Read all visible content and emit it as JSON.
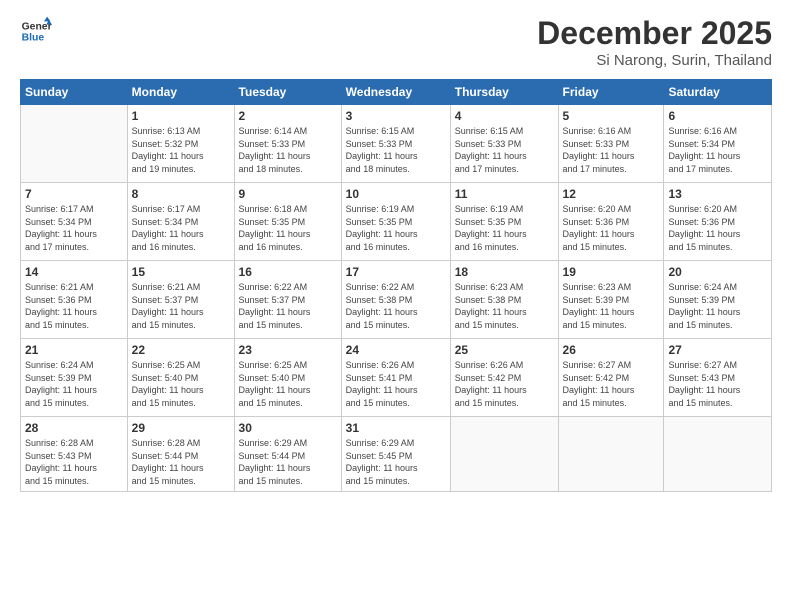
{
  "header": {
    "logo_line1": "General",
    "logo_line2": "Blue",
    "month": "December 2025",
    "location": "Si Narong, Surin, Thailand"
  },
  "weekdays": [
    "Sunday",
    "Monday",
    "Tuesday",
    "Wednesday",
    "Thursday",
    "Friday",
    "Saturday"
  ],
  "weeks": [
    [
      {
        "day": "",
        "info": ""
      },
      {
        "day": "1",
        "info": "Sunrise: 6:13 AM\nSunset: 5:32 PM\nDaylight: 11 hours\nand 19 minutes."
      },
      {
        "day": "2",
        "info": "Sunrise: 6:14 AM\nSunset: 5:33 PM\nDaylight: 11 hours\nand 18 minutes."
      },
      {
        "day": "3",
        "info": "Sunrise: 6:15 AM\nSunset: 5:33 PM\nDaylight: 11 hours\nand 18 minutes."
      },
      {
        "day": "4",
        "info": "Sunrise: 6:15 AM\nSunset: 5:33 PM\nDaylight: 11 hours\nand 17 minutes."
      },
      {
        "day": "5",
        "info": "Sunrise: 6:16 AM\nSunset: 5:33 PM\nDaylight: 11 hours\nand 17 minutes."
      },
      {
        "day": "6",
        "info": "Sunrise: 6:16 AM\nSunset: 5:34 PM\nDaylight: 11 hours\nand 17 minutes."
      }
    ],
    [
      {
        "day": "7",
        "info": "Sunrise: 6:17 AM\nSunset: 5:34 PM\nDaylight: 11 hours\nand 17 minutes."
      },
      {
        "day": "8",
        "info": "Sunrise: 6:17 AM\nSunset: 5:34 PM\nDaylight: 11 hours\nand 16 minutes."
      },
      {
        "day": "9",
        "info": "Sunrise: 6:18 AM\nSunset: 5:35 PM\nDaylight: 11 hours\nand 16 minutes."
      },
      {
        "day": "10",
        "info": "Sunrise: 6:19 AM\nSunset: 5:35 PM\nDaylight: 11 hours\nand 16 minutes."
      },
      {
        "day": "11",
        "info": "Sunrise: 6:19 AM\nSunset: 5:35 PM\nDaylight: 11 hours\nand 16 minutes."
      },
      {
        "day": "12",
        "info": "Sunrise: 6:20 AM\nSunset: 5:36 PM\nDaylight: 11 hours\nand 15 minutes."
      },
      {
        "day": "13",
        "info": "Sunrise: 6:20 AM\nSunset: 5:36 PM\nDaylight: 11 hours\nand 15 minutes."
      }
    ],
    [
      {
        "day": "14",
        "info": "Sunrise: 6:21 AM\nSunset: 5:36 PM\nDaylight: 11 hours\nand 15 minutes."
      },
      {
        "day": "15",
        "info": "Sunrise: 6:21 AM\nSunset: 5:37 PM\nDaylight: 11 hours\nand 15 minutes."
      },
      {
        "day": "16",
        "info": "Sunrise: 6:22 AM\nSunset: 5:37 PM\nDaylight: 11 hours\nand 15 minutes."
      },
      {
        "day": "17",
        "info": "Sunrise: 6:22 AM\nSunset: 5:38 PM\nDaylight: 11 hours\nand 15 minutes."
      },
      {
        "day": "18",
        "info": "Sunrise: 6:23 AM\nSunset: 5:38 PM\nDaylight: 11 hours\nand 15 minutes."
      },
      {
        "day": "19",
        "info": "Sunrise: 6:23 AM\nSunset: 5:39 PM\nDaylight: 11 hours\nand 15 minutes."
      },
      {
        "day": "20",
        "info": "Sunrise: 6:24 AM\nSunset: 5:39 PM\nDaylight: 11 hours\nand 15 minutes."
      }
    ],
    [
      {
        "day": "21",
        "info": "Sunrise: 6:24 AM\nSunset: 5:39 PM\nDaylight: 11 hours\nand 15 minutes."
      },
      {
        "day": "22",
        "info": "Sunrise: 6:25 AM\nSunset: 5:40 PM\nDaylight: 11 hours\nand 15 minutes."
      },
      {
        "day": "23",
        "info": "Sunrise: 6:25 AM\nSunset: 5:40 PM\nDaylight: 11 hours\nand 15 minutes."
      },
      {
        "day": "24",
        "info": "Sunrise: 6:26 AM\nSunset: 5:41 PM\nDaylight: 11 hours\nand 15 minutes."
      },
      {
        "day": "25",
        "info": "Sunrise: 6:26 AM\nSunset: 5:42 PM\nDaylight: 11 hours\nand 15 minutes."
      },
      {
        "day": "26",
        "info": "Sunrise: 6:27 AM\nSunset: 5:42 PM\nDaylight: 11 hours\nand 15 minutes."
      },
      {
        "day": "27",
        "info": "Sunrise: 6:27 AM\nSunset: 5:43 PM\nDaylight: 11 hours\nand 15 minutes."
      }
    ],
    [
      {
        "day": "28",
        "info": "Sunrise: 6:28 AM\nSunset: 5:43 PM\nDaylight: 11 hours\nand 15 minutes."
      },
      {
        "day": "29",
        "info": "Sunrise: 6:28 AM\nSunset: 5:44 PM\nDaylight: 11 hours\nand 15 minutes."
      },
      {
        "day": "30",
        "info": "Sunrise: 6:29 AM\nSunset: 5:44 PM\nDaylight: 11 hours\nand 15 minutes."
      },
      {
        "day": "31",
        "info": "Sunrise: 6:29 AM\nSunset: 5:45 PM\nDaylight: 11 hours\nand 15 minutes."
      },
      {
        "day": "",
        "info": ""
      },
      {
        "day": "",
        "info": ""
      },
      {
        "day": "",
        "info": ""
      }
    ]
  ]
}
